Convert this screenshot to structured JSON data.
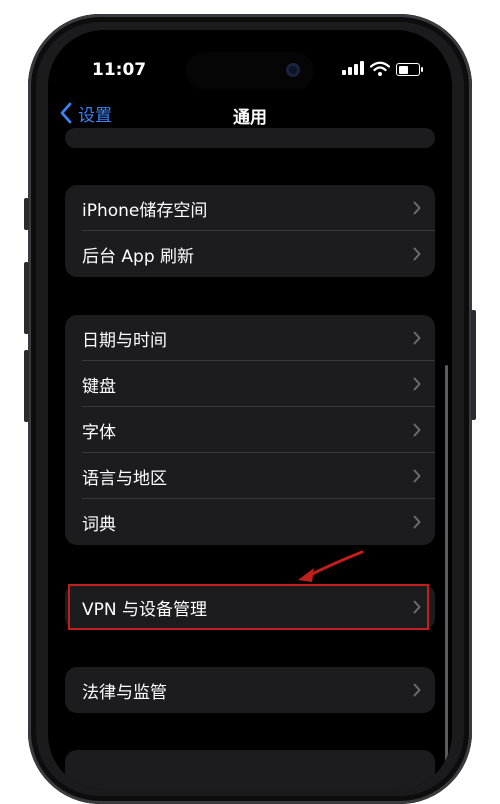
{
  "status_bar": {
    "time": "11:07"
  },
  "nav": {
    "back_label": "设置",
    "title": "通用"
  },
  "groups": [
    {
      "items": [
        {
          "label": "iPhone储存空间"
        },
        {
          "label": "后台 App 刷新"
        }
      ]
    },
    {
      "items": [
        {
          "label": "日期与时间"
        },
        {
          "label": "键盘"
        },
        {
          "label": "字体"
        },
        {
          "label": "语言与地区"
        },
        {
          "label": "词典"
        }
      ]
    },
    {
      "items": [
        {
          "label": "VPN 与设备管理"
        }
      ]
    },
    {
      "items": [
        {
          "label": "法律与监管"
        }
      ]
    }
  ],
  "colors": {
    "accent": "#3b82f6",
    "cell_background": "#1c1c1e",
    "annotation_red": "#c21e1e"
  },
  "icons": [
    "back-chevron-icon",
    "chevron-right-icon",
    "signal-icon",
    "wifi-icon",
    "battery-icon"
  ]
}
